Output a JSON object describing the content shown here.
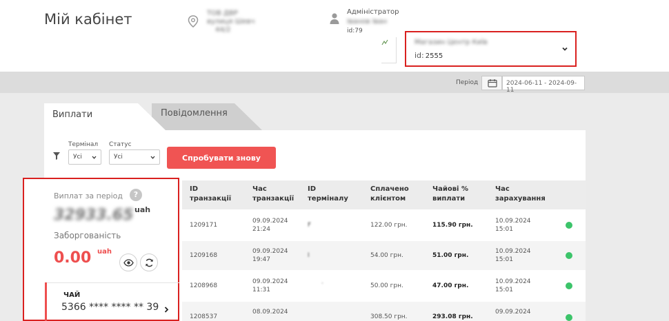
{
  "header": {
    "title": "Мій кабінет",
    "address_lines": [
      "ТОВ ДВР",
      "вулиця Шевч",
      "44/2"
    ],
    "admin_role": "Адміністратор",
    "admin_name": "Іванов Іван",
    "admin_id": "id:79",
    "store_name": "Магазин Центр Київ",
    "store_id_label": "id:",
    "store_id": "2555"
  },
  "period": {
    "label": "Період",
    "value": "2024-06-11 - 2024-09-11"
  },
  "tabs": [
    {
      "label": "Виплати",
      "active": true
    },
    {
      "label": "Повідомлення",
      "active": false
    }
  ],
  "filters": {
    "terminal_label": "Термінал",
    "terminal_value": "Усі",
    "status_label": "Статус",
    "status_value": "Усі",
    "retry_label": "Спробувати знову"
  },
  "summary": {
    "payouts_label": "Виплат за період",
    "help": "?",
    "payouts_value": "32933.65",
    "currency": "uah",
    "debt_label": "Заборгованість",
    "debt_value": "0.00",
    "debt_currency": "uah",
    "card_name": "ЧАЙ",
    "card_number": "5366 **** **** ** 39"
  },
  "table": {
    "columns": [
      "ID транзакції",
      "Час транзакції",
      "ID терміналу",
      "Сплачено клієнтом",
      "Чайові % виплати",
      "Час зарахування"
    ],
    "rows": [
      {
        "id": "1209171",
        "time": "09.09.2024 21:24",
        "terminal": "F",
        "paid": "122.00 грн.",
        "tip": "115.90 грн.",
        "credited": "10.09.2024 15:01",
        "status_color": "#3cc46a"
      },
      {
        "id": "1209168",
        "time": "09.09.2024 19:47",
        "terminal": "I",
        "paid": "54.00 грн.",
        "tip": "51.00 грн.",
        "credited": "10.09.2024 15:01",
        "status_color": "#3cc46a"
      },
      {
        "id": "1208968",
        "time": "09.09.2024 11:31",
        "terminal": "·",
        "paid": "50.00 грн.",
        "tip": "47.00 грн.",
        "credited": "10.09.2024 15:01",
        "status_color": "#3cc46a"
      },
      {
        "id": "1208537",
        "time": "08.09.2024",
        "terminal": "",
        "paid": "308.50 грн.",
        "tip": "293.08 грн.",
        "credited": "09.09.2024",
        "status_color": "#3cc46a"
      }
    ]
  }
}
